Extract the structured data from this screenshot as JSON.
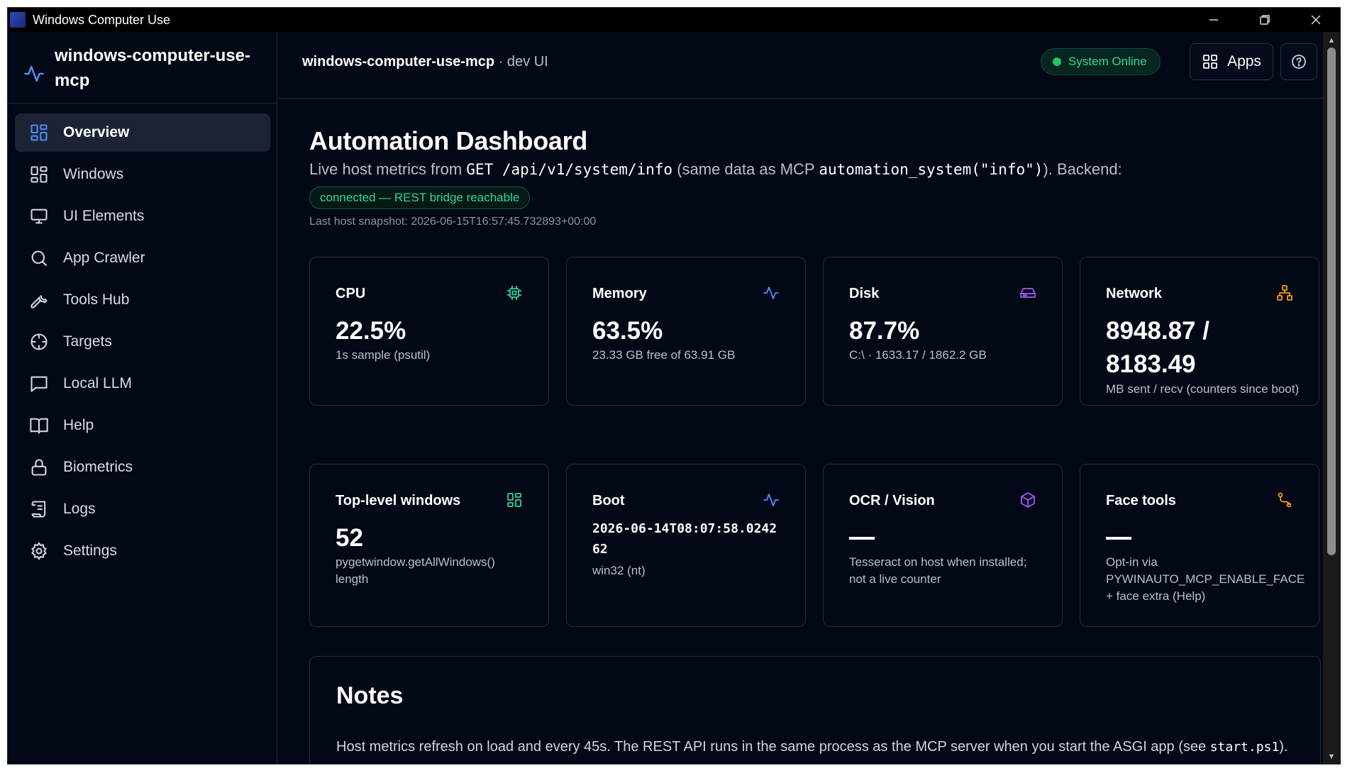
{
  "window": {
    "title": "Windows Computer Use"
  },
  "sidebar": {
    "brand": "windows-computer-use-mcp",
    "items": [
      {
        "label": "Overview",
        "icon": "grid-icon",
        "active": true
      },
      {
        "label": "Windows",
        "icon": "windows-grid-icon"
      },
      {
        "label": "UI Elements",
        "icon": "monitor-icon"
      },
      {
        "label": "App Crawler",
        "icon": "search-icon"
      },
      {
        "label": "Tools Hub",
        "icon": "wrench-icon"
      },
      {
        "label": "Targets",
        "icon": "crosshair-icon"
      },
      {
        "label": "Local LLM",
        "icon": "chat-icon"
      },
      {
        "label": "Help",
        "icon": "book-icon"
      },
      {
        "label": "Biometrics",
        "icon": "lock-icon"
      },
      {
        "label": "Logs",
        "icon": "scroll-icon"
      },
      {
        "label": "Settings",
        "icon": "gear-icon"
      }
    ]
  },
  "header": {
    "project": "windows-computer-use-mcp",
    "suffix": " · dev UI",
    "status": "System Online",
    "apps_label": "Apps"
  },
  "main": {
    "title": "Automation Dashboard",
    "sub_pre": "Live host metrics from ",
    "sub_code1": "GET /api/v1/system/info",
    "sub_mid": " (same data as MCP ",
    "sub_code2": "automation_system(\"info\")",
    "sub_post": "). Backend:",
    "backend_badge": "connected — REST bridge reachable",
    "snapshot": "Last host snapshot: 2026-06-15T16:57:45.732893+00:00"
  },
  "cards": {
    "cpu": {
      "title": "CPU",
      "value": "22.5%",
      "sub": "1s sample (psutil)"
    },
    "memory": {
      "title": "Memory",
      "value": "63.5%",
      "sub": "23.33 GB free of 63.91 GB"
    },
    "disk": {
      "title": "Disk",
      "value": "87.7%",
      "sub": "C:\\ · 1633.17 / 1862.2 GB"
    },
    "network": {
      "title": "Network",
      "value": "8948.87 / 8183.49",
      "sub": "MB sent / recv (counters since boot)"
    },
    "windows": {
      "title": "Top-level windows",
      "value": "52",
      "sub": "pygetwindow.getAllWindows() length"
    },
    "boot": {
      "title": "Boot",
      "value": "2026-06-14T08:07:58.024262",
      "sub": "win32 (nt)"
    },
    "ocr": {
      "title": "OCR / Vision",
      "value": "—",
      "sub": "Tesseract on host when installed; not a live counter"
    },
    "face": {
      "title": "Face tools",
      "value": "—",
      "sub": "Opt-in via PYWINAUTO_MCP_ENABLE_FACE + face extra (Help)"
    }
  },
  "notes": {
    "title": "Notes",
    "text_pre": "Host metrics refresh on load and every 45s. The REST API runs in the same process as the MCP server when you start the ASGI app (see ",
    "text_code": "start.ps1",
    "text_post": ")."
  },
  "colors": {
    "accent_blue": "#4f8df7",
    "green": "#34d399",
    "purple": "#a855f7",
    "orange": "#f59e0b",
    "background": "#030817"
  }
}
